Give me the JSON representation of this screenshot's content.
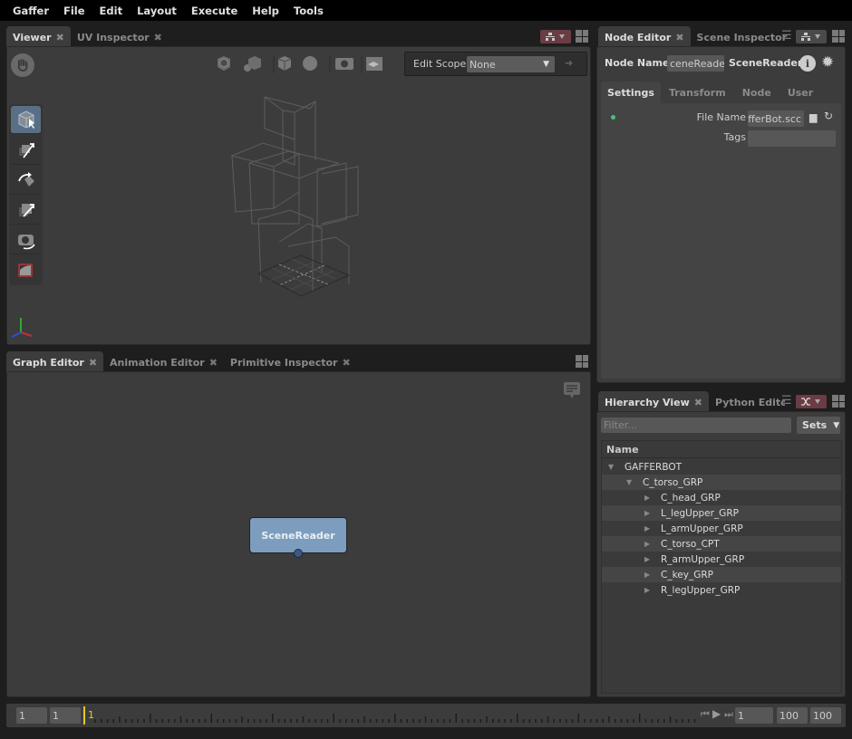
{
  "menu": [
    "Gaffer",
    "File",
    "Edit",
    "Layout",
    "Execute",
    "Help",
    "Tools"
  ],
  "viewer": {
    "tabs": [
      {
        "label": "Viewer",
        "active": true
      },
      {
        "label": "UV Inspector",
        "active": false
      }
    ],
    "edit_scope_label": "Edit Scope",
    "edit_scope_value": "None",
    "tools": [
      "selection-tool",
      "translate-tool",
      "rotate-tool",
      "scale-tool",
      "camera-tool",
      "crop-window-tool"
    ]
  },
  "graph": {
    "tabs": [
      {
        "label": "Graph Editor",
        "active": true
      },
      {
        "label": "Animation Editor",
        "active": false
      },
      {
        "label": "Primitive Inspector",
        "active": false
      }
    ],
    "node_label": "SceneReader",
    "node_color": "#7d9dbf"
  },
  "node_editor": {
    "tabs": [
      {
        "label": "Node Editor",
        "active": true
      },
      {
        "label": "Scene Inspector",
        "active": false
      }
    ],
    "node_name_label": "Node Name",
    "node_name_value": "ceneReader",
    "node_type": "SceneReader",
    "subtabs": [
      "Settings",
      "Transform",
      "Node",
      "User"
    ],
    "active_subtab": "Settings",
    "file_name_label": "File Name",
    "file_name_value": "afferBot.scc",
    "tags_label": "Tags",
    "tags_value": ""
  },
  "hierarchy": {
    "tabs": [
      {
        "label": "Hierarchy View",
        "active": true
      },
      {
        "label": "Python Editor",
        "active": false
      }
    ],
    "filter_placeholder": "Filter...",
    "sets_label": "Sets",
    "column_header": "Name",
    "rows": [
      {
        "label": "GAFFERBOT",
        "depth": 0,
        "expanded": true
      },
      {
        "label": "C_torso_GRP",
        "depth": 1,
        "expanded": true
      },
      {
        "label": "C_head_GRP",
        "depth": 2,
        "expanded": false
      },
      {
        "label": "L_legUpper_GRP",
        "depth": 2,
        "expanded": false
      },
      {
        "label": "L_armUpper_GRP",
        "depth": 2,
        "expanded": false
      },
      {
        "label": "C_torso_CPT",
        "depth": 2,
        "expanded": false
      },
      {
        "label": "R_armUpper_GRP",
        "depth": 2,
        "expanded": false
      },
      {
        "label": "C_key_GRP",
        "depth": 2,
        "expanded": false
      },
      {
        "label": "R_legUpper_GRP",
        "depth": 2,
        "expanded": false
      }
    ]
  },
  "timeline": {
    "start_outer": "1",
    "start_inner": "1",
    "current_frame": "1",
    "frame_field": "1",
    "end_inner": "100",
    "end_outer": "100"
  }
}
